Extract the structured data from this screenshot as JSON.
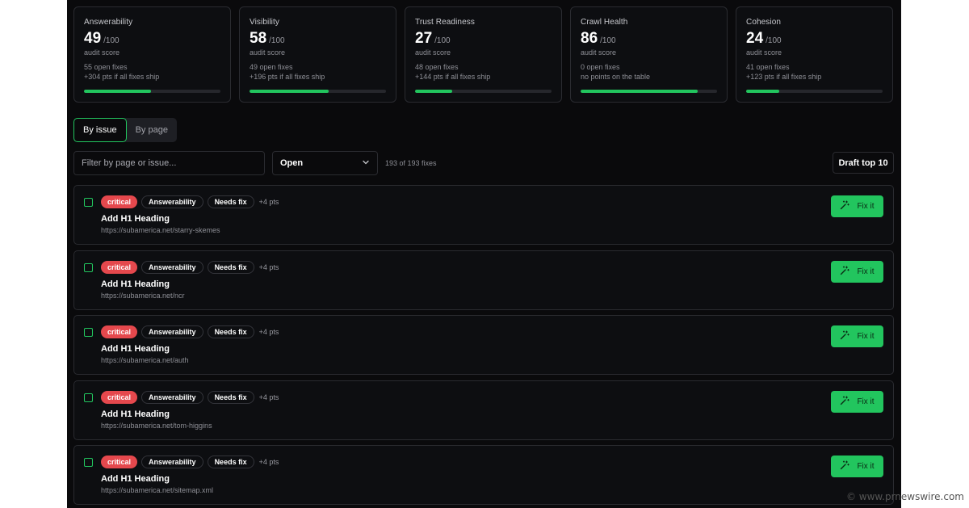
{
  "cards": [
    {
      "title": "Answerability",
      "score": "49",
      "max": "/100",
      "sub": "audit score",
      "fixes": "55 open fixes",
      "gain": "+304 pts if all fixes ship",
      "progress": 0.49
    },
    {
      "title": "Visibility",
      "score": "58",
      "max": "/100",
      "sub": "audit score",
      "fixes": "49 open fixes",
      "gain": "+196 pts if all fixes ship",
      "progress": 0.58
    },
    {
      "title": "Trust Readiness",
      "score": "27",
      "max": "/100",
      "sub": "audit score",
      "fixes": "48 open fixes",
      "gain": "+144 pts if all fixes ship",
      "progress": 0.27
    },
    {
      "title": "Crawl Health",
      "score": "86",
      "max": "/100",
      "sub": "audit score",
      "fixes": "0 open fixes",
      "gain": "no points on the table",
      "progress": 0.86
    },
    {
      "title": "Cohesion",
      "score": "24",
      "max": "/100",
      "sub": "audit score",
      "fixes": "41 open fixes",
      "gain": "+123 pts if all fixes ship",
      "progress": 0.24
    }
  ],
  "view_toggle": {
    "by_issue": "By issue",
    "by_page": "By page",
    "active": "by_issue"
  },
  "filter": {
    "placeholder": "Filter by page or issue..."
  },
  "status_select": {
    "value": "Open"
  },
  "count_text": "193 of 193 fixes",
  "draft_button": "Draft top 10",
  "fix_button_label": "Fix it",
  "rows": [
    {
      "severity": "critical",
      "category": "Answerability",
      "state": "Needs fix",
      "pts": "+4 pts",
      "title": "Add H1 Heading",
      "url": "https://subamerica.net/starry-skemes"
    },
    {
      "severity": "critical",
      "category": "Answerability",
      "state": "Needs fix",
      "pts": "+4 pts",
      "title": "Add H1 Heading",
      "url": "https://subamerica.net/ncr"
    },
    {
      "severity": "critical",
      "category": "Answerability",
      "state": "Needs fix",
      "pts": "+4 pts",
      "title": "Add H1 Heading",
      "url": "https://subamerica.net/auth"
    },
    {
      "severity": "critical",
      "category": "Answerability",
      "state": "Needs fix",
      "pts": "+4 pts",
      "title": "Add H1 Heading",
      "url": "https://subamerica.net/tom-higgins"
    },
    {
      "severity": "critical",
      "category": "Answerability",
      "state": "Needs fix",
      "pts": "+4 pts",
      "title": "Add H1 Heading",
      "url": "https://subamerica.net/sitemap.xml"
    }
  ],
  "colors": {
    "accent": "#22c55e",
    "critical": "#e5484d",
    "background": "#0a0a0c"
  },
  "icons": {
    "fix": "magic-wand-icon",
    "select": "chevron-down-icon"
  },
  "watermark": "© www.prnewswire.com"
}
